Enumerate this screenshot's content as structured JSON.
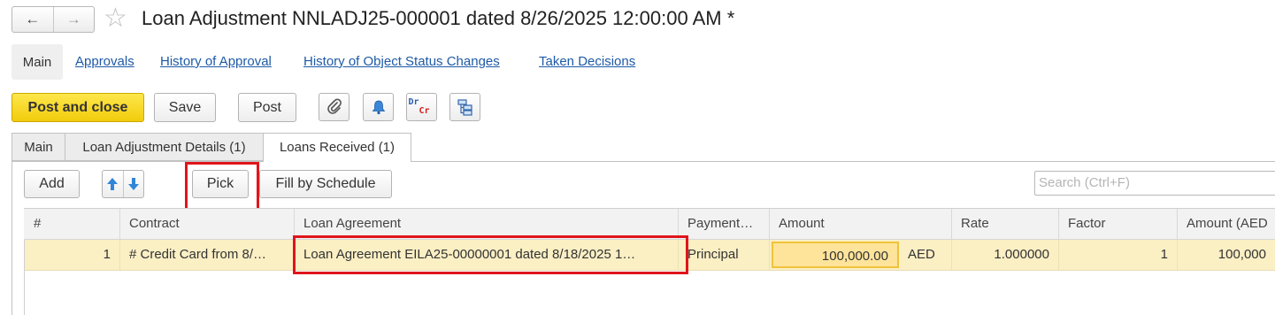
{
  "window": {
    "back_icon": "←",
    "forward_icon": "→",
    "favorite_icon": "☆",
    "title": "Loan Adjustment NNLADJ25-000001 dated 8/26/2025 12:00:00 AM *"
  },
  "sections": [
    {
      "label": "Main",
      "active": true
    },
    {
      "label": "Approvals"
    },
    {
      "label": "History of Approval"
    },
    {
      "label": "History of Object Status Changes"
    },
    {
      "label": "Taken Decisions"
    }
  ],
  "toolbar": {
    "post_and_close": "Post and close",
    "save": "Save",
    "post": "Post",
    "dr": "Dr",
    "cr": "Cr"
  },
  "tabs": [
    {
      "label": "Main"
    },
    {
      "label": "Loan Adjustment Details (1)"
    },
    {
      "label": "Loans Received (1)",
      "active": true
    }
  ],
  "table_toolbar": {
    "add": "Add",
    "pick": "Pick",
    "fill_by_schedule": "Fill by Schedule",
    "search_placeholder": "Search (Ctrl+F)"
  },
  "table": {
    "columns": [
      "#",
      "Contract",
      "Loan Agreement",
      "Payment…",
      "Amount",
      "Rate",
      "Factor",
      "Amount (AED"
    ],
    "rows": [
      {
        "num": "1",
        "contract": "# Credit Card from 8/…",
        "loan_agreement": "Loan Agreement EILA25-00000001 dated 8/18/2025 1…",
        "payment": "Principal",
        "amount": "100,000.00",
        "currency": "AED",
        "rate": "1.000000",
        "factor": "1",
        "amount_aed": "100,000"
      }
    ]
  },
  "colors": {
    "accent_yellow": "#f5d21f",
    "highlight_red": "#e0151b",
    "selected_row": "#fbefc4",
    "link_blue": "#1e5aa8"
  }
}
